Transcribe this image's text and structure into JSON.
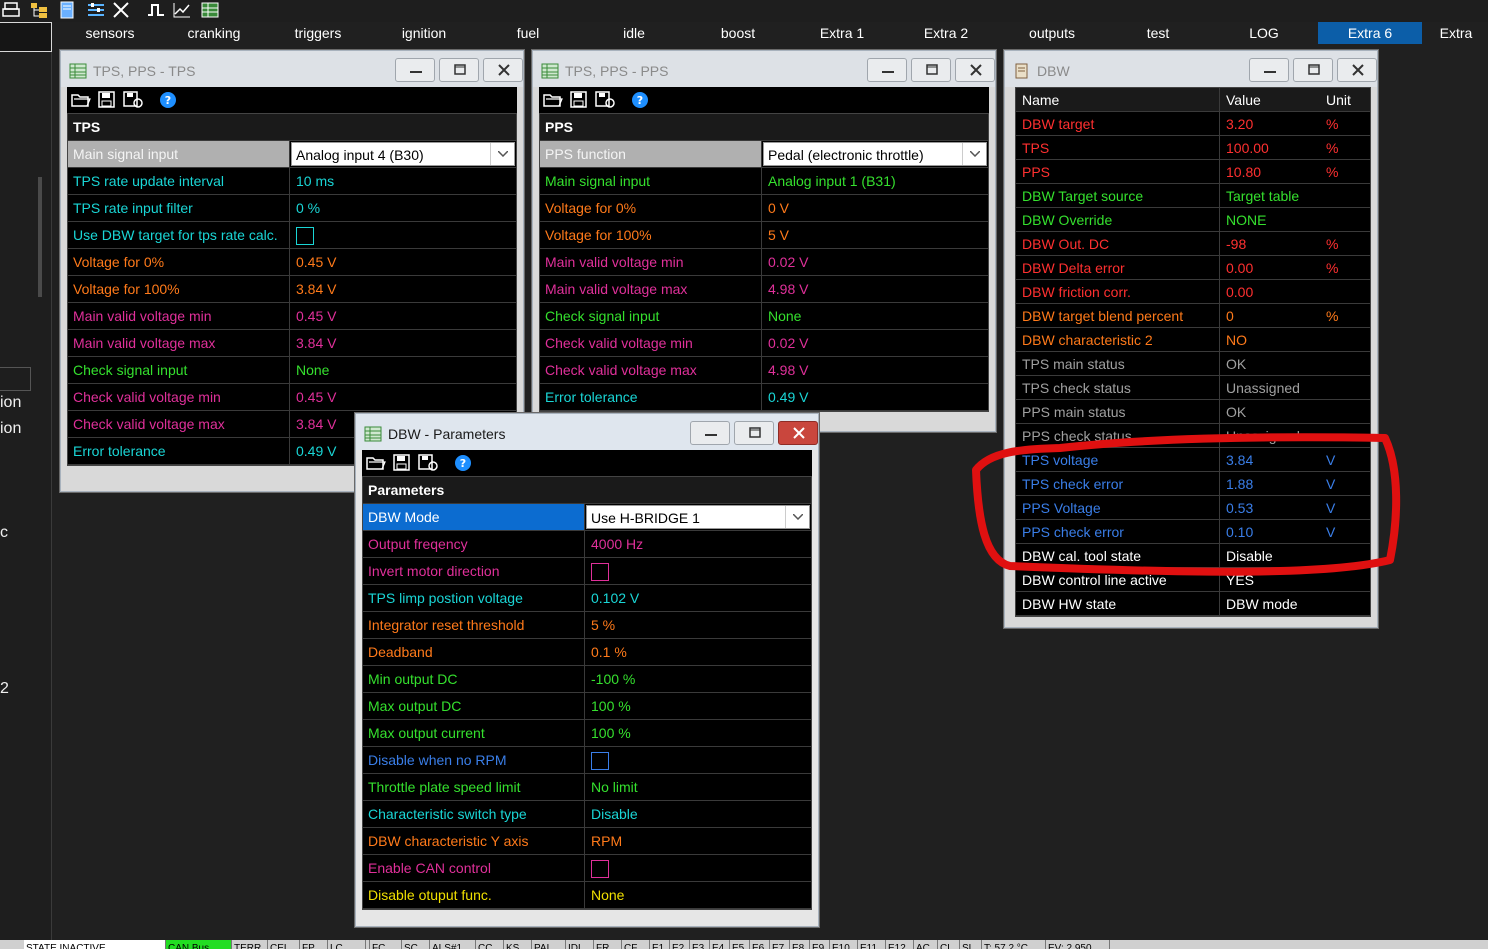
{
  "colors": {
    "accent_tab": "#0c5ea8",
    "cyan": "#1ad6d6",
    "orange": "#ff7a1a",
    "magenta": "#e0309a",
    "green": "#35e02e",
    "red": "#ff3030",
    "blue": "#3a7ee8",
    "yellow": "#f0e000",
    "white": "#ffffff",
    "gray": "#a0a0a0",
    "highlight_circle": "#e01010"
  },
  "toolbar": {
    "icons": [
      "print-icon",
      "folder-tree-icon",
      "document-icon",
      "sliders-icon",
      "tools-icon",
      "pulse-icon",
      "chart-icon",
      "table-icon"
    ]
  },
  "tabs": [
    {
      "label": "sensors",
      "active": false
    },
    {
      "label": "cranking",
      "active": false
    },
    {
      "label": "triggers",
      "active": false
    },
    {
      "label": "ignition",
      "active": false
    },
    {
      "label": "fuel",
      "active": false
    },
    {
      "label": "idle",
      "active": false
    },
    {
      "label": "boost",
      "active": false
    },
    {
      "label": "Extra 1",
      "active": false
    },
    {
      "label": "Extra 2",
      "active": false
    },
    {
      "label": "outputs",
      "active": false
    },
    {
      "label": "test",
      "active": false
    },
    {
      "label": "LOG",
      "active": false
    },
    {
      "label": "Extra 6",
      "active": true
    },
    {
      "label": "Extra",
      "active": false
    }
  ],
  "left_fragments": [
    "ion",
    "ion",
    "c",
    "2"
  ],
  "tps_window": {
    "title": "TPS, PPS - TPS",
    "section": "TPS",
    "rows": [
      {
        "label": "Main signal input",
        "value": "Analog input 4 (B30)",
        "kind": "combo",
        "color": "white",
        "selected": true
      },
      {
        "label": "TPS rate update interval",
        "value": "10 ms",
        "color": "cyan"
      },
      {
        "label": "TPS rate input filter",
        "value": "0 %",
        "color": "cyan"
      },
      {
        "label": "Use DBW target for tps rate calc.",
        "value": "",
        "kind": "checkbox",
        "color": "cyan"
      },
      {
        "label": "Voltage for 0%",
        "value": "0.45 V",
        "color": "orange"
      },
      {
        "label": "Voltage for 100%",
        "value": "3.84 V",
        "color": "orange"
      },
      {
        "label": "Main valid voltage min",
        "value": "0.45 V",
        "color": "magenta"
      },
      {
        "label": "Main valid voltage max",
        "value": "3.84 V",
        "color": "magenta"
      },
      {
        "label": "Check signal input",
        "value": "None",
        "color": "green"
      },
      {
        "label": "Check valid voltage min",
        "value": "0.45 V",
        "color": "magenta"
      },
      {
        "label": "Check valid voltage max",
        "value": "3.84 V",
        "color": "magenta"
      },
      {
        "label": "Error tolerance",
        "value": "0.49 V",
        "color": "cyan"
      }
    ]
  },
  "pps_window": {
    "title": "TPS, PPS - PPS",
    "section": "PPS",
    "rows": [
      {
        "label": "PPS function",
        "value": "Pedal (electronic throttle)",
        "kind": "combo",
        "color": "white",
        "selected": true
      },
      {
        "label": "Main signal input",
        "value": "Analog input 1 (B31)",
        "color": "green"
      },
      {
        "label": "Voltage for 0%",
        "value": "0 V",
        "color": "orange"
      },
      {
        "label": "Voltage for 100%",
        "value": "5 V",
        "color": "orange"
      },
      {
        "label": "Main valid voltage min",
        "value": "0.02 V",
        "color": "magenta"
      },
      {
        "label": "Main valid voltage max",
        "value": "4.98 V",
        "color": "magenta"
      },
      {
        "label": "Check signal input",
        "value": "None",
        "color": "green"
      },
      {
        "label": "Check valid voltage min",
        "value": "0.02 V",
        "color": "magenta"
      },
      {
        "label": "Check valid voltage max",
        "value": "4.98 V",
        "color": "magenta"
      },
      {
        "label": "Error tolerance",
        "value": "0.49 V",
        "color": "cyan"
      }
    ]
  },
  "params_window": {
    "title": "DBW - Parameters",
    "section": "Parameters",
    "rows": [
      {
        "label": "DBW Mode",
        "value": "Use H-BRIDGE 1",
        "kind": "combo",
        "color": "white",
        "selected": true
      },
      {
        "label": "Output freqency",
        "value": "4000 Hz",
        "color": "magenta"
      },
      {
        "label": "Invert motor direction",
        "value": "",
        "kind": "checkbox",
        "color": "magenta"
      },
      {
        "label": "TPS limp postion voltage",
        "value": "0.102 V",
        "color": "cyan"
      },
      {
        "label": "Integrator reset threshold",
        "value": "5 %",
        "color": "orange"
      },
      {
        "label": "Deadband",
        "value": "0.1 %",
        "color": "orange"
      },
      {
        "label": "Min output DC",
        "value": "-100 %",
        "color": "green"
      },
      {
        "label": "Max output DC",
        "value": "100 %",
        "color": "green"
      },
      {
        "label": "Max output current",
        "value": "100 %",
        "color": "green"
      },
      {
        "label": "Disable when no RPM",
        "value": "",
        "kind": "checkbox",
        "color": "blue"
      },
      {
        "label": "Throttle plate speed limit",
        "value": "No limit",
        "color": "green"
      },
      {
        "label": "Characteristic switch type",
        "value": "Disable",
        "color": "cyan"
      },
      {
        "label": "DBW characteristic Y axis",
        "value": "RPM",
        "color": "orange"
      },
      {
        "label": "Enable CAN control",
        "value": "",
        "kind": "checkbox",
        "color": "magenta"
      },
      {
        "label": "Disable otuput func.",
        "value": "None",
        "color": "yellow"
      }
    ]
  },
  "dbw_window": {
    "title": "DBW",
    "headers": {
      "name": "Name",
      "value": "Value",
      "unit": "Unit"
    },
    "rows": [
      {
        "name": "DBW target",
        "value": "3.20",
        "unit": "%",
        "color": "red"
      },
      {
        "name": "TPS",
        "value": "100.00",
        "unit": "%",
        "color": "red"
      },
      {
        "name": "PPS",
        "value": "10.80",
        "unit": "%",
        "color": "red"
      },
      {
        "name": "DBW Target source",
        "value": "Target table",
        "unit": "",
        "color": "green"
      },
      {
        "name": "DBW Override",
        "value": "NONE",
        "unit": "",
        "color": "green"
      },
      {
        "name": "DBW Out. DC",
        "value": "-98",
        "unit": "%",
        "color": "red"
      },
      {
        "name": "DBW Delta error",
        "value": "0.00",
        "unit": "%",
        "color": "red"
      },
      {
        "name": "DBW friction corr.",
        "value": "0.00",
        "unit": "",
        "color": "red"
      },
      {
        "name": "DBW target blend percent",
        "value": "0",
        "unit": "%",
        "color": "orange"
      },
      {
        "name": "DBW characteristic 2",
        "value": "NO",
        "unit": "",
        "color": "orange"
      },
      {
        "name": "TPS main status",
        "value": "OK",
        "unit": "",
        "color": "gray"
      },
      {
        "name": "TPS check status",
        "value": "Unassigned",
        "unit": "",
        "color": "gray"
      },
      {
        "name": "PPS main status",
        "value": "OK",
        "unit": "",
        "color": "gray"
      },
      {
        "name": "PPS check status",
        "value": "Unassigned",
        "unit": "",
        "color": "gray"
      },
      {
        "name": "TPS voltage",
        "value": "3.84",
        "unit": "V",
        "color": "blue"
      },
      {
        "name": "TPS check error",
        "value": "1.88",
        "unit": "V",
        "color": "blue"
      },
      {
        "name": "PPS Voltage",
        "value": "0.53",
        "unit": "V",
        "color": "blue"
      },
      {
        "name": "PPS check error",
        "value": "0.10",
        "unit": "V",
        "color": "blue"
      },
      {
        "name": "DBW cal. tool state",
        "value": "Disable",
        "unit": "",
        "color": "white"
      },
      {
        "name": "DBW control line active",
        "value": "YES",
        "unit": "",
        "color": "white"
      },
      {
        "name": "DBW HW state",
        "value": "DBW mode",
        "unit": "",
        "color": "white"
      }
    ]
  },
  "statusbar": [
    {
      "text": "STATE INACTIVE",
      "bg": "#ffffff"
    },
    {
      "text": "CAN Bus",
      "bg": "#22dd22"
    },
    {
      "text": "TERR",
      "bg": "#d0d0d0"
    },
    {
      "text": "CEL",
      "bg": "#d0d0d0"
    },
    {
      "text": "FP",
      "bg": "#d0d0d0"
    },
    {
      "text": "LC",
      "bg": "#d0d0d0"
    },
    {
      "text": "",
      "bg": "#d0d0d0"
    },
    {
      "text": "FC",
      "bg": "#d0d0d0"
    },
    {
      "text": "SC",
      "bg": "#d0d0d0"
    },
    {
      "text": "ALS#1",
      "bg": "#d0d0d0"
    },
    {
      "text": "CC",
      "bg": "#d0d0d0"
    },
    {
      "text": "KS",
      "bg": "#d0d0d0"
    },
    {
      "text": "PAL",
      "bg": "#d0d0d0"
    },
    {
      "text": "IDL",
      "bg": "#d0d0d0"
    },
    {
      "text": "FR",
      "bg": "#d0d0d0"
    },
    {
      "text": "CF",
      "bg": "#d0d0d0"
    },
    {
      "text": "E1",
      "bg": "#d0d0d0"
    },
    {
      "text": "E2",
      "bg": "#d0d0d0"
    },
    {
      "text": "E3",
      "bg": "#d0d0d0"
    },
    {
      "text": "E4",
      "bg": "#d0d0d0"
    },
    {
      "text": "E5",
      "bg": "#d0d0d0"
    },
    {
      "text": "E6",
      "bg": "#d0d0d0"
    },
    {
      "text": "E7",
      "bg": "#d0d0d0"
    },
    {
      "text": "E8",
      "bg": "#d0d0d0"
    },
    {
      "text": "E9",
      "bg": "#d0d0d0"
    },
    {
      "text": "E10",
      "bg": "#d0d0d0"
    },
    {
      "text": "E11",
      "bg": "#d0d0d0"
    },
    {
      "text": "E12",
      "bg": "#d0d0d0"
    },
    {
      "text": "AC",
      "bg": "#d0d0d0"
    },
    {
      "text": "CL",
      "bg": "#d0d0d0"
    },
    {
      "text": "SL",
      "bg": "#d0d0d0"
    },
    {
      "text": "T: 57.2 °C",
      "bg": "#d0d0d0"
    },
    {
      "text": "EV: 2.950",
      "bg": "#d0d0d0"
    }
  ]
}
